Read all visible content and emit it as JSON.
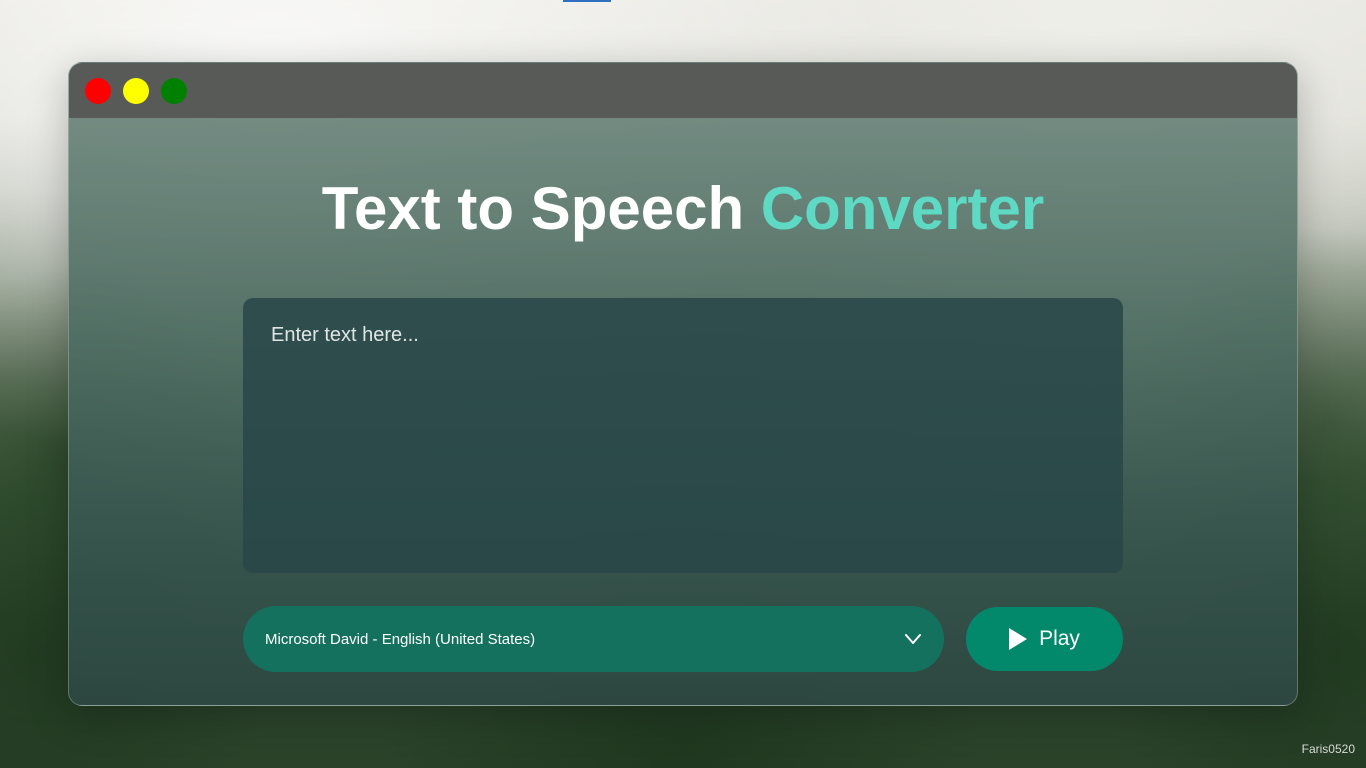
{
  "window": {
    "controls": {
      "close_color": "#ff0000",
      "minimize_color": "#ffff00",
      "maximize_color": "#008000"
    }
  },
  "header": {
    "title_main": "Text to Speech ",
    "title_accent": "Converter",
    "accent_color": "#5dd9c4"
  },
  "text_input": {
    "value": "",
    "placeholder": "Enter text here..."
  },
  "voice_select": {
    "selected": "Microsoft David - English (United States)",
    "icon": "chevron-down-icon"
  },
  "play_button": {
    "label": "Play",
    "icon": "play-icon",
    "color": "#02896c"
  },
  "footer": {
    "watermark": "Faris0520"
  }
}
